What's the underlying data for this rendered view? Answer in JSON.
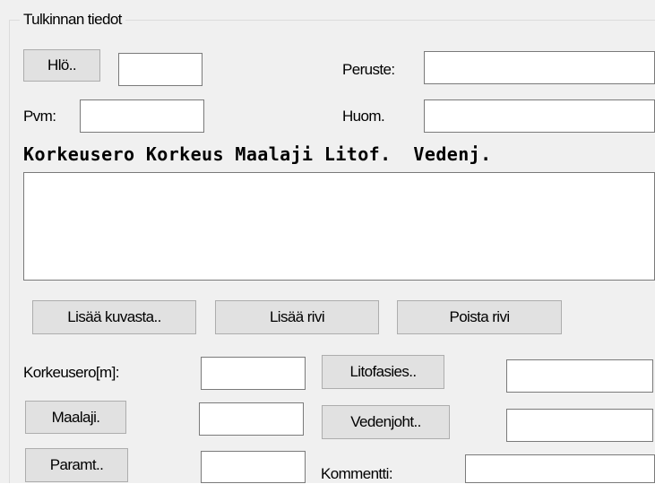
{
  "group": {
    "title": "Tulkinnan tiedot"
  },
  "top": {
    "hlo_button": "Hlö..",
    "hlo_value": "",
    "peruste_label": "Peruste:",
    "peruste_value": "",
    "pvm_label": "Pvm:",
    "pvm_value": "",
    "huom_label": "Huom.",
    "huom_value": ""
  },
  "table": {
    "header": "Korkeusero Korkeus Maalaji Litof.  Vedenj.",
    "rows": []
  },
  "row_buttons": {
    "add_from_image": "Lisää kuvasta..",
    "add_row": "Lisää rivi",
    "remove_row": "Poista rivi"
  },
  "fields": {
    "korkeusero_label": "Korkeusero[m]:",
    "korkeusero_value": "",
    "litofasies_button": "Litofasies..",
    "litofasies_value": "",
    "maalaji_button": "Maalaji.",
    "maalaji_value": "",
    "vedenjoht_button": "Vedenjoht..",
    "vedenjoht_value": "",
    "paramt_button": "Paramt..",
    "paramt_value": "",
    "kommentti_label": "Kommentti:",
    "kommentti_value": ""
  }
}
